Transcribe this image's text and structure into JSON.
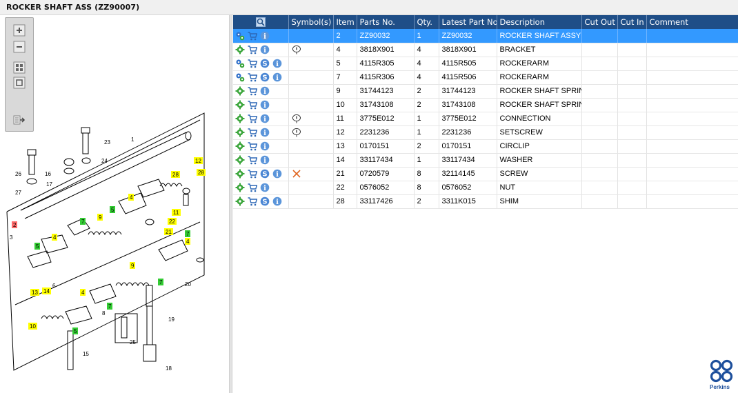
{
  "window": {
    "title": "ROCKER SHAFT ASS (ZZ90007)"
  },
  "zoom_tools": [
    {
      "name": "zoom-in-icon"
    },
    {
      "name": "zoom-out-icon"
    },
    {
      "name": "fit-all-icon"
    },
    {
      "name": "fit-window-icon"
    },
    {
      "name": "export-icon"
    }
  ],
  "table": {
    "columns": [
      "",
      "Symbol(s)",
      "Item",
      "Parts No.",
      "Qty.",
      "Latest Part No.",
      "Description",
      "Cut Out",
      "Cut In",
      "Comment"
    ],
    "rows": [
      {
        "icons": [
          "gears",
          "cart",
          "info"
        ],
        "symbol": "",
        "item": "2",
        "part_no": "ZZ90032",
        "qty": "1",
        "latest": "ZZ90032",
        "description": "ROCKER SHAFT ASSY - M",
        "cut_out": "",
        "cut_in": "",
        "comment": "",
        "selected": true
      },
      {
        "icons": [
          "gear",
          "cart",
          "info"
        ],
        "symbol": "balloon",
        "item": "4",
        "part_no": "3818X901",
        "qty": "4",
        "latest": "3818X901",
        "description": "BRACKET",
        "cut_out": "",
        "cut_in": "",
        "comment": ""
      },
      {
        "icons": [
          "gears",
          "cart",
          "s",
          "info"
        ],
        "symbol": "",
        "item": "5",
        "part_no": "4115R305",
        "qty": "4",
        "latest": "4115R505",
        "description": "ROCKERARM",
        "cut_out": "",
        "cut_in": "",
        "comment": ""
      },
      {
        "icons": [
          "gears",
          "cart",
          "s",
          "info"
        ],
        "symbol": "",
        "item": "7",
        "part_no": "4115R306",
        "qty": "4",
        "latest": "4115R506",
        "description": "ROCKERARM",
        "cut_out": "",
        "cut_in": "",
        "comment": ""
      },
      {
        "icons": [
          "gear",
          "cart",
          "info"
        ],
        "symbol": "",
        "item": "9",
        "part_no": "31744123",
        "qty": "2",
        "latest": "31744123",
        "description": "ROCKER SHAFT SPRING",
        "cut_out": "",
        "cut_in": "",
        "comment": ""
      },
      {
        "icons": [
          "gear",
          "cart",
          "info"
        ],
        "symbol": "",
        "item": "10",
        "part_no": "31743108",
        "qty": "2",
        "latest": "31743108",
        "description": "ROCKER SHAFT SPRING",
        "cut_out": "",
        "cut_in": "",
        "comment": ""
      },
      {
        "icons": [
          "gear",
          "cart",
          "info"
        ],
        "symbol": "balloon",
        "item": "11",
        "part_no": "3775E012",
        "qty": "1",
        "latest": "3775E012",
        "description": "CONNECTION",
        "cut_out": "",
        "cut_in": "",
        "comment": ""
      },
      {
        "icons": [
          "gear",
          "cart",
          "info"
        ],
        "symbol": "balloon",
        "item": "12",
        "part_no": "2231236",
        "qty": "1",
        "latest": "2231236",
        "description": "SETSCREW",
        "cut_out": "",
        "cut_in": "",
        "comment": ""
      },
      {
        "icons": [
          "gear",
          "cart",
          "info"
        ],
        "symbol": "",
        "item": "13",
        "part_no": "0170151",
        "qty": "2",
        "latest": "0170151",
        "description": "CIRCLIP",
        "cut_out": "",
        "cut_in": "",
        "comment": ""
      },
      {
        "icons": [
          "gear",
          "cart",
          "info"
        ],
        "symbol": "",
        "item": "14",
        "part_no": "33117434",
        "qty": "1",
        "latest": "33117434",
        "description": "WASHER",
        "cut_out": "",
        "cut_in": "",
        "comment": ""
      },
      {
        "icons": [
          "gear",
          "cart",
          "s",
          "info"
        ],
        "symbol": "cross",
        "item": "21",
        "part_no": "0720579",
        "qty": "8",
        "latest": "32114145",
        "description": "SCREW",
        "cut_out": "",
        "cut_in": "",
        "comment": ""
      },
      {
        "icons": [
          "gear",
          "cart",
          "info"
        ],
        "symbol": "",
        "item": "22",
        "part_no": "0576052",
        "qty": "8",
        "latest": "0576052",
        "description": "NUT",
        "cut_out": "",
        "cut_in": "",
        "comment": ""
      },
      {
        "icons": [
          "gear",
          "cart",
          "s",
          "info"
        ],
        "symbol": "",
        "item": "28",
        "part_no": "33117426",
        "qty": "2",
        "latest": "3311K015",
        "description": "SHIM",
        "cut_out": "",
        "cut_in": "",
        "comment": ""
      }
    ]
  },
  "drawing_labels": [
    {
      "text": "1",
      "style": "plain"
    },
    {
      "text": "2",
      "style": "red"
    },
    {
      "text": "3",
      "style": "plain"
    },
    {
      "text": "4",
      "style": "yellow"
    },
    {
      "text": "4",
      "style": "yellow"
    },
    {
      "text": "4",
      "style": "yellow"
    },
    {
      "text": "4",
      "style": "yellow"
    },
    {
      "text": "5",
      "style": "green"
    },
    {
      "text": "5",
      "style": "green"
    },
    {
      "text": "5",
      "style": "green"
    },
    {
      "text": "6",
      "style": "plain"
    },
    {
      "text": "7",
      "style": "green"
    },
    {
      "text": "7",
      "style": "green"
    },
    {
      "text": "7",
      "style": "green"
    },
    {
      "text": "7",
      "style": "green"
    },
    {
      "text": "8",
      "style": "plain"
    },
    {
      "text": "9",
      "style": "yellow"
    },
    {
      "text": "9",
      "style": "yellow"
    },
    {
      "text": "10",
      "style": "yellow"
    },
    {
      "text": "11",
      "style": "yellow"
    },
    {
      "text": "12",
      "style": "yellow"
    },
    {
      "text": "13",
      "style": "yellow"
    },
    {
      "text": "14",
      "style": "yellow"
    },
    {
      "text": "15",
      "style": "plain"
    },
    {
      "text": "16",
      "style": "plain"
    },
    {
      "text": "17",
      "style": "plain"
    },
    {
      "text": "18",
      "style": "plain"
    },
    {
      "text": "19",
      "style": "plain"
    },
    {
      "text": "20",
      "style": "plain"
    },
    {
      "text": "21",
      "style": "yellow"
    },
    {
      "text": "22",
      "style": "yellow"
    },
    {
      "text": "23",
      "style": "plain"
    },
    {
      "text": "24",
      "style": "plain"
    },
    {
      "text": "25",
      "style": "plain"
    },
    {
      "text": "26",
      "style": "plain"
    },
    {
      "text": "27",
      "style": "plain"
    },
    {
      "text": "28",
      "style": "yellow"
    },
    {
      "text": "28",
      "style": "yellow"
    }
  ],
  "brand": {
    "name": "Perkins",
    "color": "#1d4f9c"
  },
  "colors": {
    "header": "#1f4e87",
    "selected": "#3399ff",
    "label_yellow": "#ffff00",
    "label_green": "#33cc33",
    "label_red": "#ff6b6b"
  }
}
